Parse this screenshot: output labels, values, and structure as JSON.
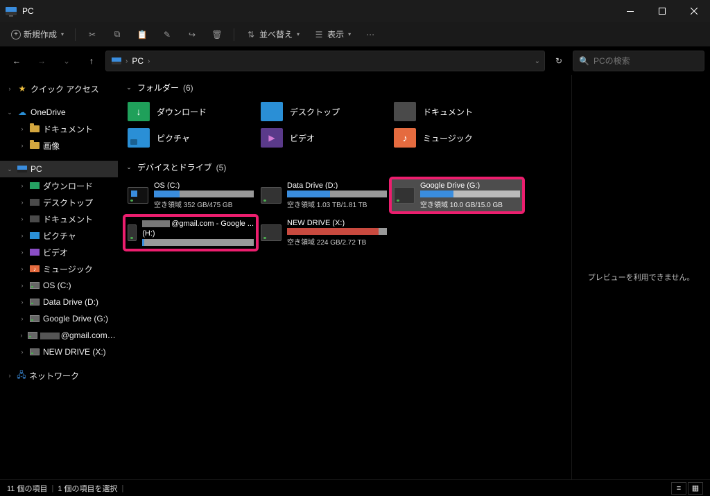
{
  "window": {
    "title": "PC"
  },
  "toolbar": {
    "new": "新規作成",
    "sort": "並べ替え",
    "view": "表示"
  },
  "nav": {
    "breadcrumb_root": "PC",
    "search_placeholder": "PCの検索"
  },
  "sidebar": {
    "quick_access": "クイック アクセス",
    "onedrive": "OneDrive",
    "onedrive_children": [
      {
        "label": "ドキュメント"
      },
      {
        "label": "画像"
      }
    ],
    "pc": "PC",
    "pc_children": [
      {
        "label": "ダウンロード",
        "cls": "ic-down"
      },
      {
        "label": "デスクトップ",
        "cls": "ic-doc"
      },
      {
        "label": "ドキュメント",
        "cls": "ic-doc"
      },
      {
        "label": "ピクチャ",
        "cls": "ic-pic"
      },
      {
        "label": "ビデオ",
        "cls": "ic-vid"
      },
      {
        "label": "ミュージック",
        "cls": "ic-music"
      },
      {
        "label": "OS (C:)",
        "cls": "ic-drive"
      },
      {
        "label": "Data Drive (D:)",
        "cls": "ic-drive"
      },
      {
        "label": "Google Drive (G:)",
        "cls": "ic-drive"
      },
      {
        "label": "@gmail.com - Goog",
        "cls": "ic-drive",
        "truncated_prefix": true
      },
      {
        "label": "NEW DRIVE (X:)",
        "cls": "ic-drive"
      }
    ],
    "network": "ネットワーク"
  },
  "main": {
    "group_folders_label": "フォルダー",
    "group_folders_count": "(6)",
    "folders": [
      {
        "label": "ダウンロード",
        "cls": "fi-down"
      },
      {
        "label": "デスクトップ",
        "cls": "fi-desk"
      },
      {
        "label": "ドキュメント",
        "cls": "fi-doc"
      },
      {
        "label": "ピクチャ",
        "cls": "fi-pic"
      },
      {
        "label": "ビデオ",
        "cls": "fi-vid"
      },
      {
        "label": "ミュージック",
        "cls": "fi-music"
      }
    ],
    "group_drives_label": "デバイスとドライブ",
    "group_drives_count": "(5)",
    "drives": [
      {
        "name": "OS (C:)",
        "free": "空き領域 352 GB/475 GB",
        "pct": 26,
        "warn": false,
        "os": true
      },
      {
        "name": "Data Drive (D:)",
        "free": "空き領域 1.03 TB/1.81 TB",
        "pct": 43,
        "warn": false
      },
      {
        "name": "Google Drive (G:)",
        "free": "空き領域 10.0 GB/15.0 GB",
        "pct": 33,
        "warn": false,
        "selected": true,
        "hl": true
      },
      {
        "name": "@gmail.com - Google ...",
        "subname": "(H:)",
        "free": "",
        "pct": 2,
        "warn": false,
        "hl": true,
        "truncated_prefix": true
      },
      {
        "name": "NEW DRIVE (X:)",
        "free": "空き領域 224 GB/2.72 TB",
        "pct": 92,
        "warn": true
      }
    ]
  },
  "preview": {
    "no_preview": "プレビューを利用できません。"
  },
  "status": {
    "items": "11 個の項目",
    "selected": "1 個の項目を選択"
  }
}
